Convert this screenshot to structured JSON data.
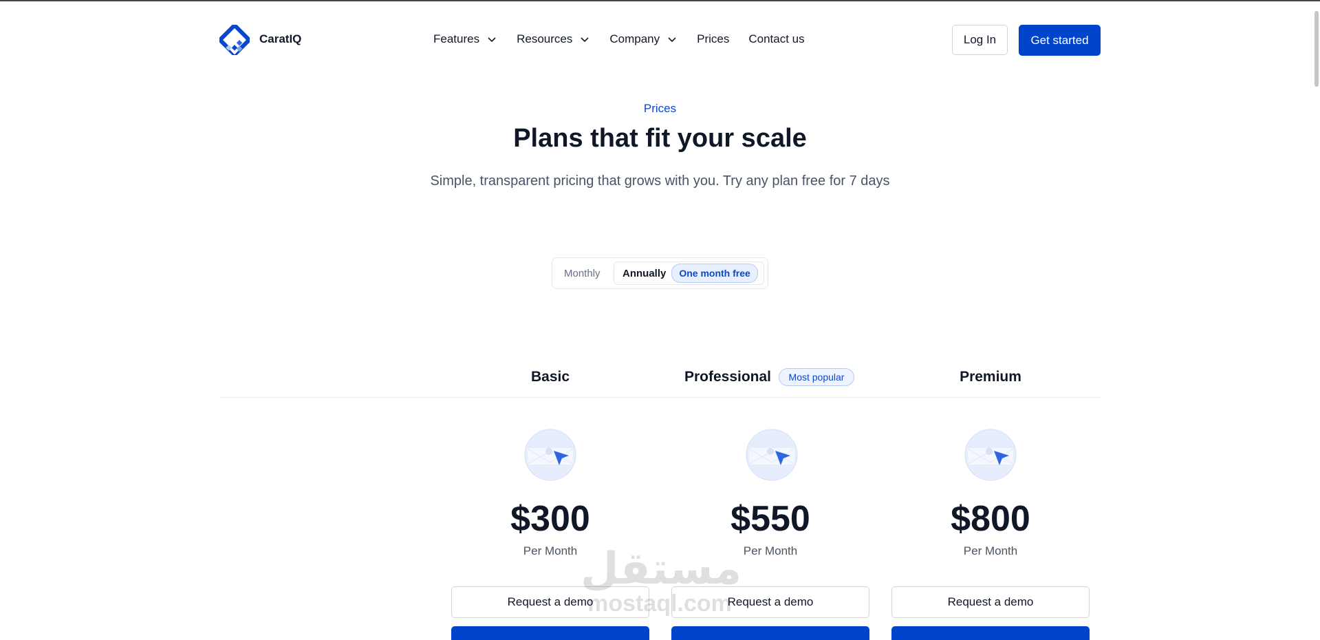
{
  "header": {
    "brand": "CaratIQ",
    "nav": [
      {
        "label": "Features",
        "has_dropdown": true
      },
      {
        "label": "Resources",
        "has_dropdown": true
      },
      {
        "label": "Company",
        "has_dropdown": true
      },
      {
        "label": "Prices",
        "has_dropdown": false
      },
      {
        "label": "Contact us",
        "has_dropdown": false
      }
    ],
    "login_label": "Log In",
    "cta_label": "Get started"
  },
  "hero": {
    "eyebrow": "Prices",
    "title": "Plans that fit your scale",
    "subtitle": "Simple, transparent pricing that grows with you. Try any plan free for 7 days"
  },
  "billing_toggle": {
    "monthly_label": "Monthly",
    "annual_label": "Annually",
    "annual_badge": "One month free",
    "selected": "Annually"
  },
  "plans": [
    {
      "name": "Basic",
      "price": "$300",
      "period": "Per Month",
      "demo_label": "Request a demo"
    },
    {
      "name": "Professional",
      "badge": "Most popular",
      "price": "$550",
      "period": "Per Month",
      "demo_label": "Request a demo"
    },
    {
      "name": "Premium",
      "price": "$800",
      "period": "Per Month",
      "demo_label": "Request a demo"
    }
  ],
  "watermark": {
    "arabic": "مستقل",
    "latin": "mostaql.com"
  },
  "colors": {
    "accent": "#0044cc",
    "accent_text": "#0a47cc",
    "badge_bg": "#e8efff",
    "text": "#101828",
    "muted": "#475467"
  },
  "icons": [
    "logo-diamond-icon",
    "chevron-down-icon",
    "envelope-cursor-icon"
  ]
}
